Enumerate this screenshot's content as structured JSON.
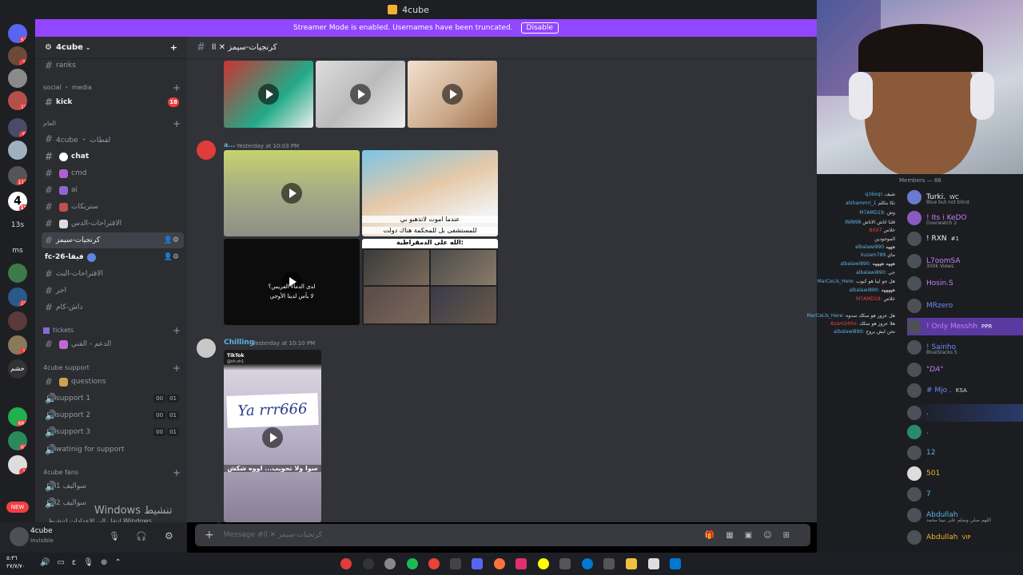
{
  "window": {
    "title": "4cube"
  },
  "banner": {
    "text": "Streamer Mode is enabled. Usernames have been truncated.",
    "button": "Disable"
  },
  "server_icons": [
    {
      "badge": "53"
    },
    {
      "badge": "1"
    },
    {
      "badge": ""
    },
    {
      "badge": "18"
    },
    {
      "badge": "6"
    },
    {
      "badge": ""
    },
    {
      "badge": "111"
    },
    {
      "badge": "18"
    },
    {
      "label": "13s"
    },
    {
      "label": "ms"
    },
    {
      "badge": ""
    },
    {
      "badge": "18"
    },
    {
      "badge": ""
    },
    {
      "badge": "1"
    },
    {
      "badge": ""
    },
    {
      "badge": "884"
    },
    {
      "badge": "61"
    },
    {
      "badge": "1"
    },
    {
      "label": "NEW"
    }
  ],
  "sidebar": {
    "server_name": "4cube",
    "channels": [
      {
        "name": "ranks"
      },
      {
        "name": "social ・ media",
        "type": "category"
      },
      {
        "name": "kick",
        "badge": "18"
      },
      {
        "name": "العام",
        "type": "category"
      },
      {
        "name": "4cube ・ لقطات"
      },
      {
        "name": "chat"
      },
      {
        "name": "cmd"
      },
      {
        "name": "ai"
      },
      {
        "name": "ستريكات"
      },
      {
        "name": "الاقتراحات-الدس"
      },
      {
        "name": "كرنجيات-سيمز"
      },
      {
        "name": "fc-26-فيفا"
      },
      {
        "name": "الاقتراحات-البث"
      },
      {
        "name": "اجر"
      },
      {
        "name": "داش-كام"
      },
      {
        "name": "tickets",
        "type": "category"
      },
      {
        "name": "الدعم - الفني"
      },
      {
        "name": "4cube support",
        "type": "category"
      },
      {
        "name": "questions"
      },
      {
        "name": "support 1",
        "counts": [
          "00",
          "01"
        ]
      },
      {
        "name": "support 2",
        "counts": [
          "00",
          "01"
        ]
      },
      {
        "name": "support 3",
        "counts": [
          "00",
          "01"
        ]
      },
      {
        "name": "watinig for support"
      },
      {
        "name": "4cube fans",
        "type": "category"
      },
      {
        "name": "سواليف 1"
      },
      {
        "name": "سواليف 2"
      }
    ]
  },
  "user_panel": {
    "name": "4cube",
    "status": "Invisible"
  },
  "windows_activation": {
    "title": "Windows تنشيط",
    "sub": "انتقل إلى الإعدادات لتنشيط Windows"
  },
  "chat": {
    "channel_header": "كرنجيات-سيمز ✕ اا",
    "messages": [
      {
        "author": "a...",
        "time": "Yesterday at 10:03 PM",
        "captions": [
          "عندما اموت لاتذهبو بي",
          "للمستشفى بل للمحكمة هناك دولت",
          "الله على الدمقراطية:",
          "لدى الدماء الفريس؟",
          "لا يأس لدينا الأوجي"
        ]
      },
      {
        "author": "Chilling",
        "time": "Yesterday at 10:10 PM",
        "captions": [
          "TikTok",
          "@sh.sh1",
          "Ya rrr666",
          "سوا ولا تحويب... اووه شكش"
        ]
      }
    ],
    "composer_placeholder": "Message #كرنجيات-سيمز ✕ اا"
  },
  "members": {
    "header": "Members — 86",
    "list": [
      {
        "name": "Turki.",
        "tag": "WC",
        "sub": "Blue but not blind."
      },
      {
        "name": "! Its i KeDO",
        "sub": "Overwatch 2"
      },
      {
        "name": "! RXN",
        "tag": "#1"
      },
      {
        "name": "L7oomSA",
        "sub": "300k Views"
      },
      {
        "name": "Hosin.S"
      },
      {
        "name": "MRzero"
      },
      {
        "name": "! Only Messhh",
        "tag": "PPR"
      },
      {
        "name": "! Sainho",
        "sub": "BlueStacks 5"
      },
      {
        "name": "\"DA\""
      },
      {
        "name": "# Mjo .",
        "tag": "KSA"
      },
      {
        "name": "."
      },
      {
        "name": "."
      },
      {
        "name": "12"
      },
      {
        "name": "501"
      },
      {
        "name": "7"
      },
      {
        "name": "Abdullah",
        "sub": "اللهم صلي وسلم على نبينا محمد"
      },
      {
        "name": "Abdullah",
        "tag": "VIP"
      }
    ],
    "chat_overlay": [
      {
        "user": "q16oqi:",
        "text": "شيف"
      },
      {
        "user": "alshammri_1",
        "text": "تكا بتكلم"
      },
      {
        "user": "M7AMD19:",
        "text": "وش"
      },
      {
        "user": "ININ98",
        "text": "قلنا اتاش الاتاش"
      },
      {
        "user": "BXX7",
        "text": "خلاص"
      },
      {
        "user": "",
        "text": "الموجودين"
      },
      {
        "user": "albalawi890",
        "text": "هههه"
      },
      {
        "user": "kuzam789",
        "text": "ماي"
      },
      {
        "user": "albalawi890:",
        "text": "هههه ههههه"
      },
      {
        "user": "albalawi890:",
        "text": "جي"
      },
      {
        "user": "MarCeLls_Here:",
        "text": "هل جو ايبا هو كيوب"
      },
      {
        "user": "albalawi890:",
        "text": "هههههه"
      },
      {
        "user": "M7AMD19:",
        "text": "خلاص"
      },
      {
        "user": "MarCeLls_Here:",
        "text": "هل عزوز هو سكك سدوه"
      },
      {
        "user": "Azam24Xx:",
        "text": "هلا عزوز هو سكك"
      },
      {
        "user": "albalawi890:",
        "text": "نحن ايش بروح"
      }
    ]
  },
  "taskbar": {
    "date": "٢٧/٧/٧٠",
    "time": "٥:٣٦"
  }
}
